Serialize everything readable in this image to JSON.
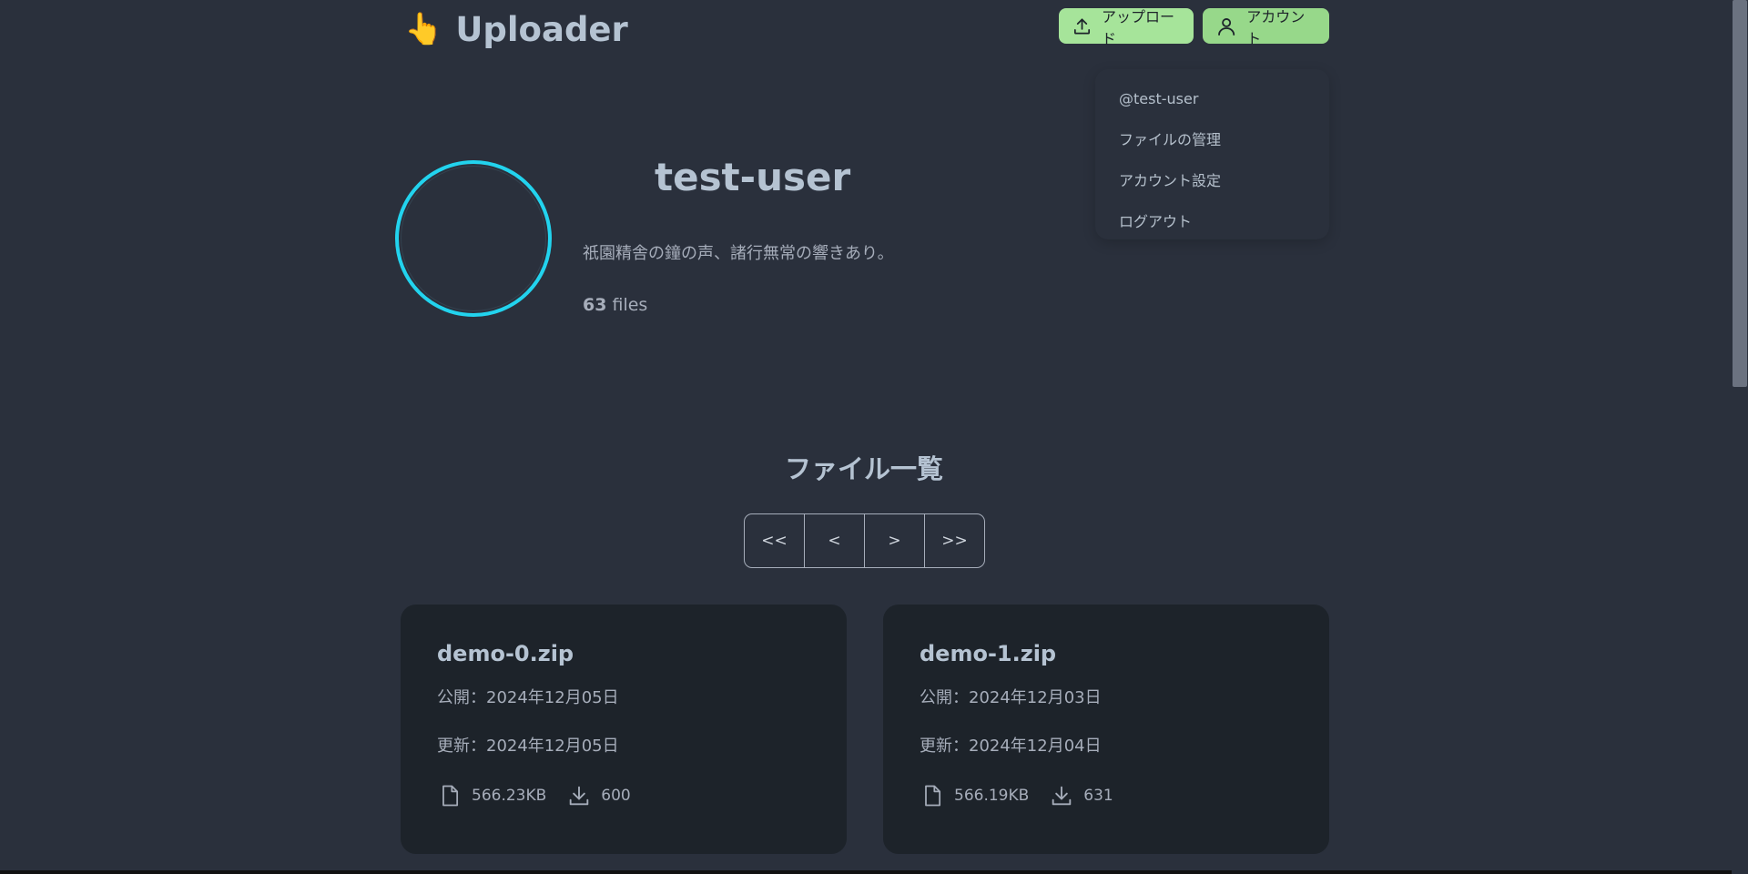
{
  "header": {
    "logo_icon": "👆",
    "app_name": "Uploader",
    "upload_label": "アップロード",
    "account_label": "アカウント"
  },
  "account_menu": {
    "handle": "@test-user",
    "items": [
      "ファイルの管理",
      "アカウント設定",
      "ログアウト"
    ]
  },
  "profile": {
    "username": "test-user",
    "bio": "祇園精舎の鐘の声、諸行無常の響きあり。",
    "file_count": "63",
    "file_count_unit": "files"
  },
  "file_list": {
    "title": "ファイル一覧",
    "pager": [
      "<<",
      "<",
      ">",
      ">>"
    ],
    "files": [
      {
        "name": "demo-0.zip",
        "published": "公開：2024年12月05日",
        "updated": "更新：2024年12月05日",
        "size": "566.23KB",
        "downloads": "600"
      },
      {
        "name": "demo-1.zip",
        "published": "公開：2024年12月03日",
        "updated": "更新：2024年12月04日",
        "size": "566.19KB",
        "downloads": "631"
      }
    ]
  },
  "colors": {
    "background": "#2a303c",
    "card": "#1d232a",
    "accent_green": "#a6e49a",
    "avatar_ring": "#22d3ee"
  }
}
